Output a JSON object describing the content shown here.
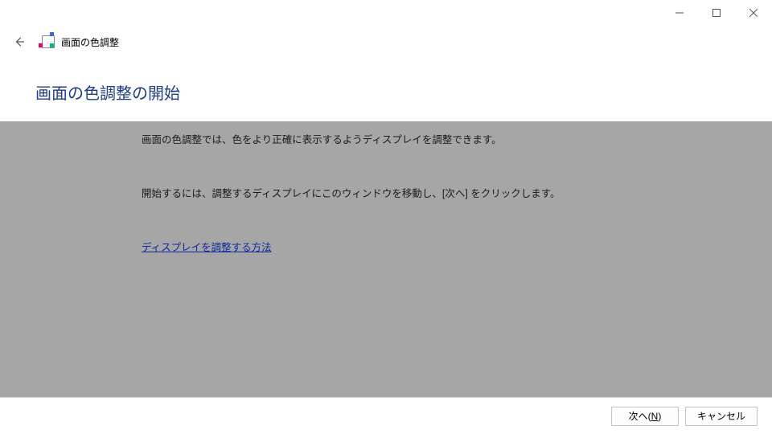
{
  "window": {
    "title": "画面の色調整"
  },
  "heading": "画面の色調整の開始",
  "body": {
    "para1": "画面の色調整では、色をより正確に表示するようディスプレイを調整できます。",
    "para2": "開始するには、調整するディスプレイにこのウィンドウを移動し、[次へ] をクリックします。",
    "link": "ディスプレイを調整する方法"
  },
  "footer": {
    "next_prefix": "次へ(",
    "next_mnemonic": "N",
    "next_suffix": ")",
    "cancel": "キャンセル"
  }
}
